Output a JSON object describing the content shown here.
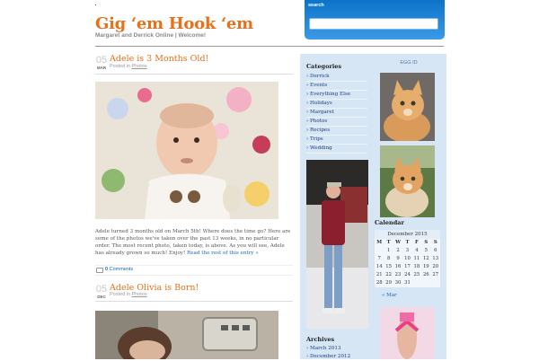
{
  "header": {
    "site_title": "Gig ‘em Hook ‘em",
    "site_description": "Margaret and Derrick Online | Welcome!"
  },
  "search": {
    "label": "search",
    "value": ""
  },
  "posts": [
    {
      "day": "05",
      "month": "MAR",
      "title": "Adele is 3 Months Old!",
      "posted_in": "Posted in",
      "category": "Photos",
      "excerpt": "Adele turned 3 months old on March 5th! Where does the time go? Here are some of the photos we've taken over the past 13 weeks, in no particular order. The most recent photo, taken today, is above. As you will see, Adele has already grown so much! Enjoy!",
      "read_more": "Read the rest of this entry »",
      "comments_count": "0",
      "comments_label": "Comments"
    },
    {
      "day": "05",
      "month": "DEC",
      "title": "Adele Olivia is Born!",
      "posted_in": "Posted in",
      "category": "Photos"
    }
  ],
  "sidebar": {
    "categories_title": "Categories",
    "categories": [
      "Derrick",
      "Events",
      "Everything Else",
      "Holidays",
      "Margaret",
      "Photos",
      "Recipes",
      "Trips",
      "Wedding"
    ],
    "egg_title": "EGG ID",
    "calendar_title": "Calendar",
    "calendar": {
      "caption": "December 2015",
      "weekdays": [
        "M",
        "T",
        "W",
        "T",
        "F",
        "S",
        "S"
      ],
      "weeks": [
        [
          "",
          "1",
          "2",
          "3",
          "4",
          "5",
          "6"
        ],
        [
          "7",
          "8",
          "9",
          "10",
          "11",
          "12",
          "13"
        ],
        [
          "14",
          "15",
          "16",
          "17",
          "18",
          "19",
          "20"
        ],
        [
          "21",
          "22",
          "23",
          "24",
          "25",
          "26",
          "27"
        ],
        [
          "28",
          "29",
          "30",
          "31",
          "",
          "",
          ""
        ]
      ],
      "prev": "« Mar"
    },
    "archives_title": "Archives",
    "archives": [
      "March 2013",
      "December 2012"
    ]
  },
  "colors": {
    "accent": "#e8701a",
    "link": "#1a66c5",
    "sidebar_bg": "#d7e6f5",
    "search_bg": "#0b73c8"
  }
}
